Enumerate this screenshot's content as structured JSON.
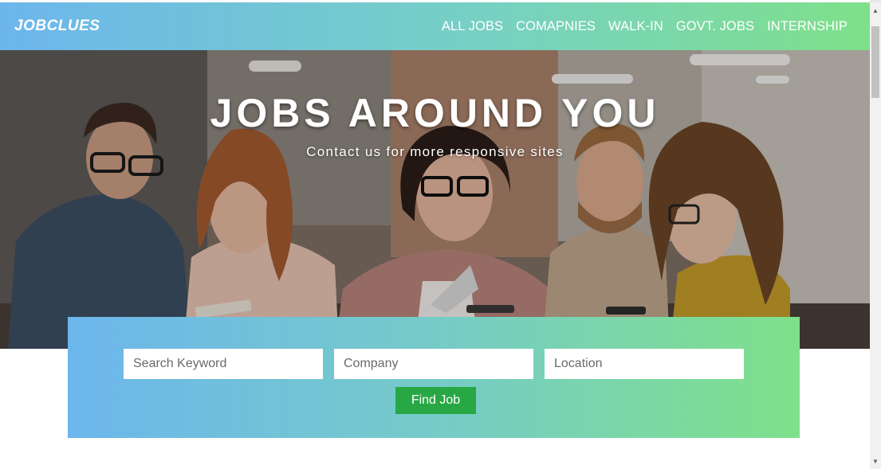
{
  "nav": {
    "brand": "JOBCLUES",
    "links": [
      "ALL JOBS",
      "COMAPNIES",
      "WALK-IN",
      "GOVT. JOBS",
      "INTERNSHIP"
    ]
  },
  "hero": {
    "title": "JOBS AROUND YOU",
    "subtitle": "Contact us for more responsive sites",
    "image": "team-meeting-photo"
  },
  "search": {
    "keyword_placeholder": "Search Keyword",
    "company_placeholder": "Company",
    "location_placeholder": "Location",
    "button_label": "Find Job"
  },
  "colors": {
    "gradient_start": "#6cb6ec",
    "gradient_end": "#7fe08a",
    "button": "#28a745"
  }
}
